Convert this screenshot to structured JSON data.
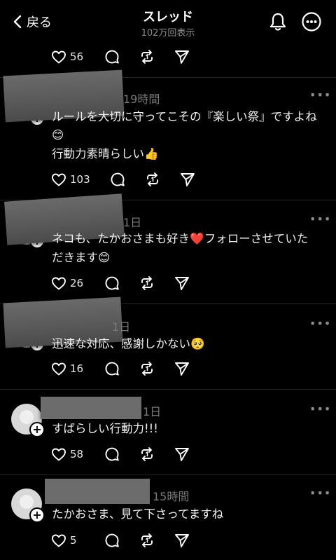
{
  "header": {
    "back_label": "戻る",
    "title": "スレッド",
    "subtitle": "102万回表示"
  },
  "top_post": {
    "like_count": "56"
  },
  "replies": [
    {
      "time": "19時間",
      "lines": [
        "ルールを大切に守ってこその『楽しい祭』ですよね",
        "😊",
        "行動力素晴らしい👍"
      ],
      "like_count": "103"
    },
    {
      "time": "1日",
      "lines": [
        "ネコも、たかおさまも好き❤️フォローさせていた",
        "だきます😊"
      ],
      "like_count": "26"
    },
    {
      "time": "1日",
      "lines": [
        "迅速な対応、感謝しかない🥺"
      ],
      "like_count": "16"
    },
    {
      "time": "1日",
      "lines": [
        "すばらしい行動力!!!"
      ],
      "like_count": "58"
    },
    {
      "time": "15時間",
      "lines": [
        "たかおさま、見て下さってますね"
      ],
      "like_count": "5"
    }
  ],
  "icons": {
    "back": "chevron-left-icon",
    "bell": "bell-icon",
    "more": "more-circle-icon",
    "like": "heart-icon",
    "comment": "comment-icon",
    "repost": "repost-icon",
    "share": "send-icon",
    "options": "more-dots-icon"
  },
  "colors": {
    "background": "#000000",
    "text": "#f2f2f2",
    "muted": "#7a7a7a",
    "divider": "#262626"
  }
}
